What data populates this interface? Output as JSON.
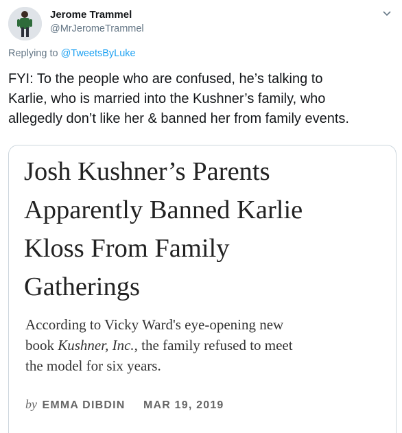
{
  "tweet": {
    "display_name": "Jerome Trammel",
    "handle": "@MrJeromeTrammel",
    "replying_prefix": "Replying to ",
    "replying_to": "@TweetsByLuke",
    "text": "FYI: To the people who are confused, he’s talking to\nKarlie, who is married into the Kushner’s family, who\nallegedly don’t like her & banned her from family events.",
    "menu_icon": "chevron-down-icon",
    "link_color": "#1da1f2"
  },
  "card": {
    "headline": "Josh Kushner’s Parents\nApparently Banned Karlie\nKloss From Family\nGatherings",
    "dek_before": "According to Vicky Ward's eye-opening new\nbook ",
    "dek_italic": "Kushner, Inc.",
    "dek_after": ", the family refused to meet\nthe model for six years.",
    "by_word": "by",
    "author": "EMMA DIBDIN",
    "date": "MAR 19, 2019"
  }
}
